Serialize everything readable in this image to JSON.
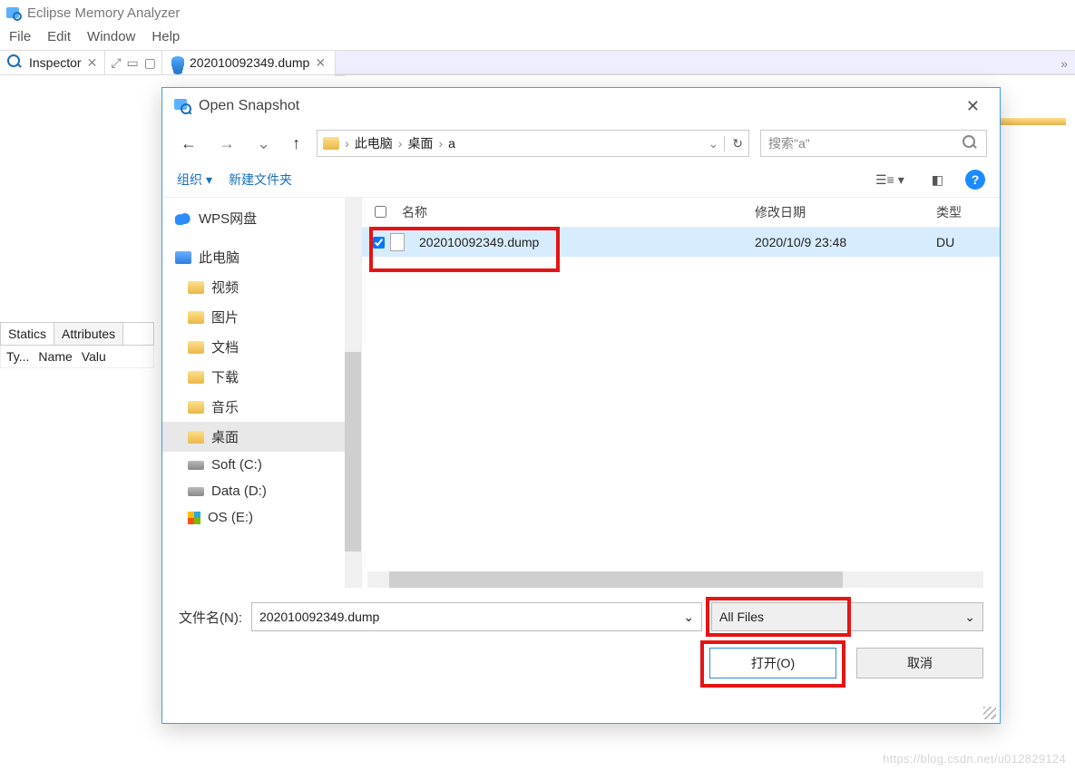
{
  "app": {
    "title": "Eclipse Memory Analyzer"
  },
  "menu": {
    "file": "File",
    "edit": "Edit",
    "window": "Window",
    "help": "Help"
  },
  "views": {
    "inspector_label": "Inspector",
    "doc_tab": "202010092349.dump",
    "sub_tabs": {
      "statics": "Statics",
      "attributes": "Attributes"
    },
    "cols": {
      "type_abbrev": "Ty...",
      "name": "Name",
      "value_abbrev": "Valu"
    }
  },
  "dialog": {
    "title": "Open Snapshot",
    "breadcrumb": [
      "此电脑",
      "桌面",
      "a"
    ],
    "search_placeholder": "搜索\"a\"",
    "organize": "组织",
    "new_folder": "新建文件夹",
    "tree": {
      "wps": "WPS网盘",
      "this_pc": "此电脑",
      "video": "视频",
      "pictures": "图片",
      "documents": "文档",
      "downloads": "下载",
      "music": "音乐",
      "desktop": "桌面",
      "drive_c": "Soft (C:)",
      "drive_d": "Data (D:)",
      "drive_e": "OS (E:)"
    },
    "columns": {
      "name": "名称",
      "date": "修改日期",
      "type": "类型"
    },
    "file": {
      "name": "202010092349.dump",
      "date": "2020/10/9 23:48",
      "type": "DU"
    },
    "filename_label": "文件名(N):",
    "filename_value": "202010092349.dump",
    "filter": "All Files",
    "open_btn": "打开(O)",
    "cancel_btn": "取消"
  },
  "watermark": "https://blog.csdn.net/u012829124"
}
